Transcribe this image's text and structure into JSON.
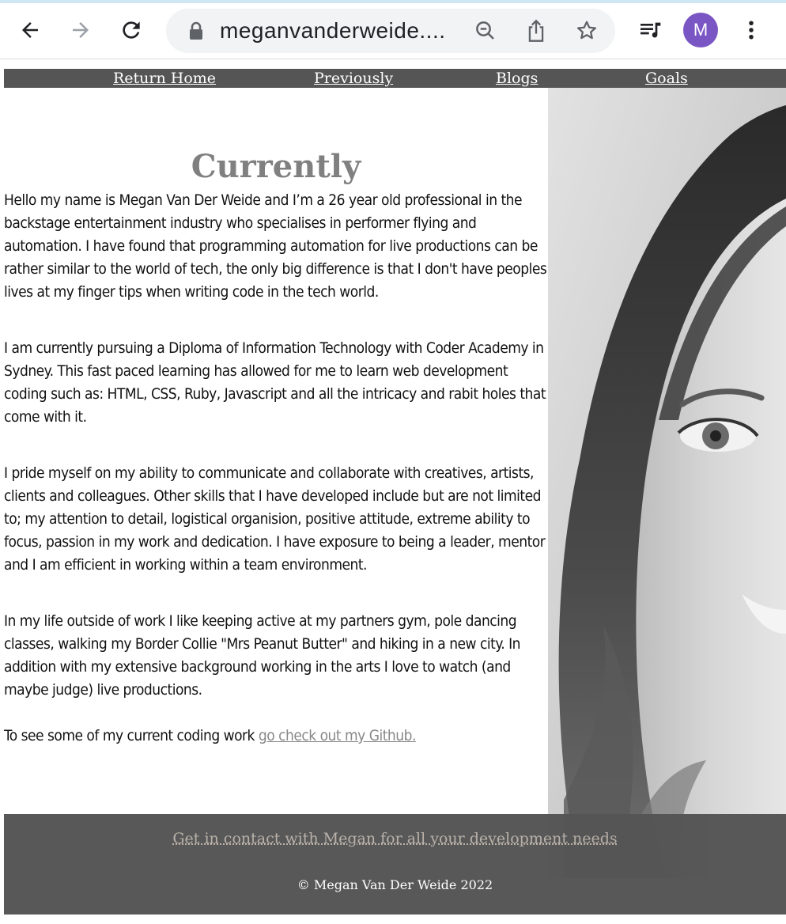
{
  "browser": {
    "url_display": "meganvanderweide....",
    "avatar_letter": "M",
    "avatar_color": "#7a55c4"
  },
  "nav": {
    "items": [
      {
        "label": "Return Home"
      },
      {
        "label": "Previously"
      },
      {
        "label": "Blogs"
      },
      {
        "label": "Goals"
      }
    ]
  },
  "main": {
    "title": "Currently",
    "paragraphs": [
      "Hello my name is Megan Van Der Weide and I’m a 26 year old professional in the backstage entertainment industry who specialises in performer flying and automation. I have found that programming automation for live productions can be rather similar to the world of tech, the only big difference is that I don't have peoples lives at my finger tips when writing code in the tech world.",
      "I am currently pursuing a Diploma of Information Technology with Coder Academy in Sydney. This fast paced learning has allowed for me to learn web development coding such as: HTML, CSS, Ruby, Javascript and all the intricacy and rabit holes that come with it.",
      "I pride myself on my ability to communicate and collaborate with creatives, artists, clients and colleagues. Other skills that I have developed include but are not limited to; my attention to detail, logistical organision, positive attitude, extreme ability to focus, passion in my work and dedication. I have exposure to being a leader, mentor and I am efficient in working within a team environment.",
      "In my life outside of work I like keeping active at my partners gym, pole dancing classes, walking my Border Collie \"Mrs Peanut Butter\" and hiking in a new city. In addition with my extensive background working in the arts I love to watch (and maybe judge) live productions."
    ],
    "github_prefix": "To see some of my current coding work ",
    "github_link": "go check out my Github."
  },
  "footer": {
    "contact_link": "Get in contact with Megan for all your development needs",
    "copyright": "© Megan Van Der Weide 2022"
  }
}
